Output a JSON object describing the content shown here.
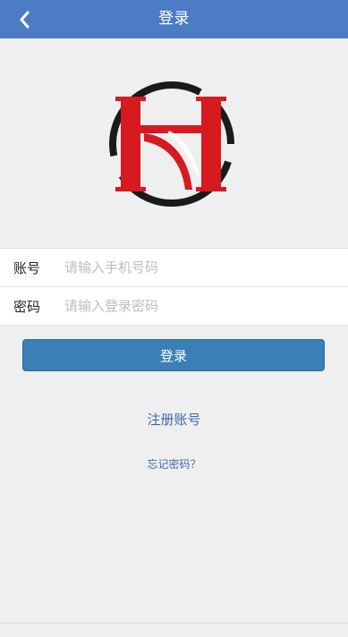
{
  "header": {
    "back_icon": "chevron-left-icon",
    "title": "登录"
  },
  "logo": {
    "name": "hs-logo-emblem",
    "colors": {
      "red": "#d71920",
      "black": "#1a1a1a"
    }
  },
  "form": {
    "account_label": "账号",
    "account_placeholder": "请输入手机号码",
    "account_value": "",
    "password_label": "密码",
    "password_placeholder": "请输入登录密码",
    "password_value": ""
  },
  "actions": {
    "login_label": "登录",
    "register_label": "注册账号",
    "forgot_label": "忘记密码？"
  },
  "colors": {
    "header_bg": "#4c7dc4",
    "button_bg": "#3a7fb5",
    "link": "#3d6aa6",
    "page_bg": "#efefef"
  }
}
